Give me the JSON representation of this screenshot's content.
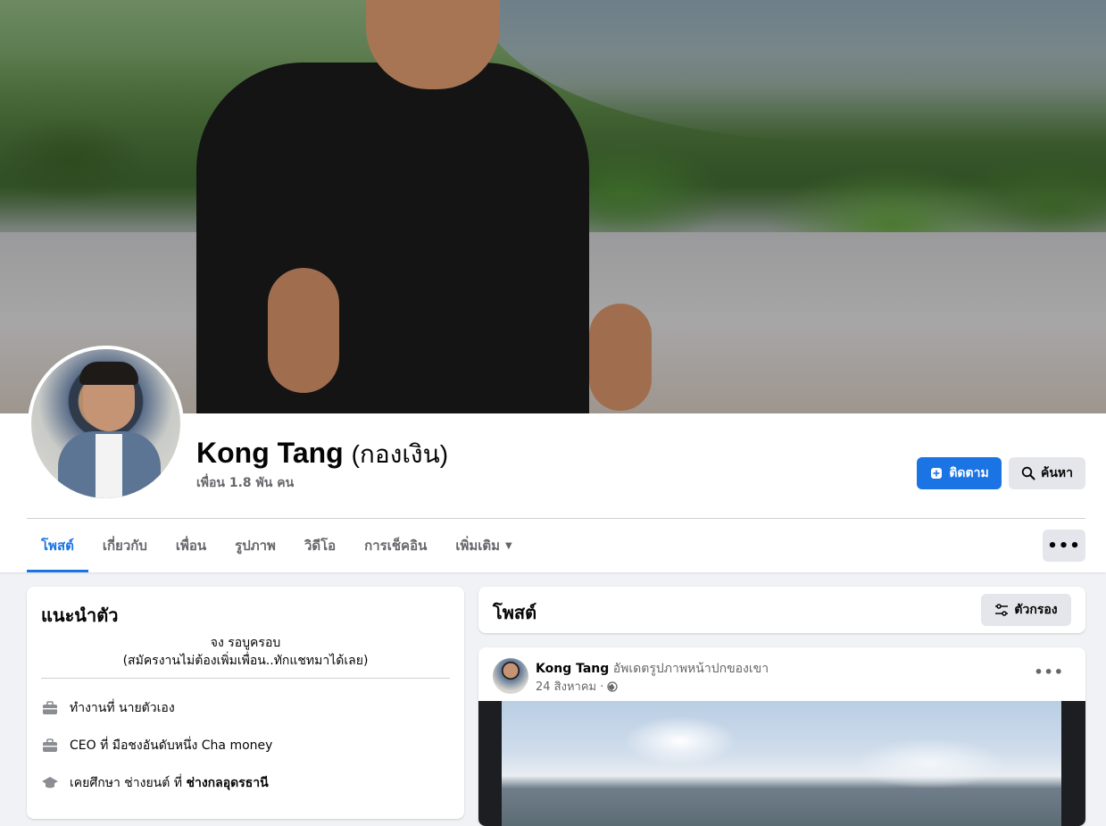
{
  "profile": {
    "name": "Kong Tang",
    "alt_name": "(กองเงิน)",
    "friends": "เพื่อน 1.8 พัน คน"
  },
  "actions": {
    "follow_label": "ติดตาม",
    "search_label": "ค้นหา"
  },
  "tabs": [
    {
      "label": "โพสต์"
    },
    {
      "label": "เกี่ยวกับ"
    },
    {
      "label": "เพื่อน"
    },
    {
      "label": "รูปภาพ"
    },
    {
      "label": "วิดีโอ"
    },
    {
      "label": "การเช็คอิน"
    },
    {
      "label": "เพิ่มเติม"
    }
  ],
  "more_menu": "•••",
  "intro": {
    "title": "แนะนำตัว",
    "bio_line1": "จง รอบูครอบ",
    "bio_line2": "(สมัครงานไม่ต้องเพิ่มเพื่อน..ทักแชทมาได้เลย)",
    "rows": [
      {
        "icon": "briefcase-icon",
        "text": "ทำงานที่ นายตัวเอง",
        "bold": ""
      },
      {
        "icon": "briefcase-icon",
        "text": "CEO ที่ มือชงอันดับหนึ่ง Cha money",
        "bold": ""
      },
      {
        "icon": "graduation-cap-icon",
        "text": "เคยศึกษา ช่างยนต์ ที่ ",
        "bold": "ช่างกลอุดรธานี"
      }
    ]
  },
  "posts": {
    "title": "โพสต์",
    "filter_label": "ตัวกรอง"
  },
  "post": {
    "author": "Kong Tang",
    "action": "อัพเดตรูปภาพหน้าปกของเขา",
    "date": "24 สิงหาคม ·",
    "menu": "•••"
  },
  "colors": {
    "accent": "#1b74e4",
    "background": "#f0f2f5",
    "secondary_text": "#65676b",
    "button_gray": "#e4e6eb"
  }
}
